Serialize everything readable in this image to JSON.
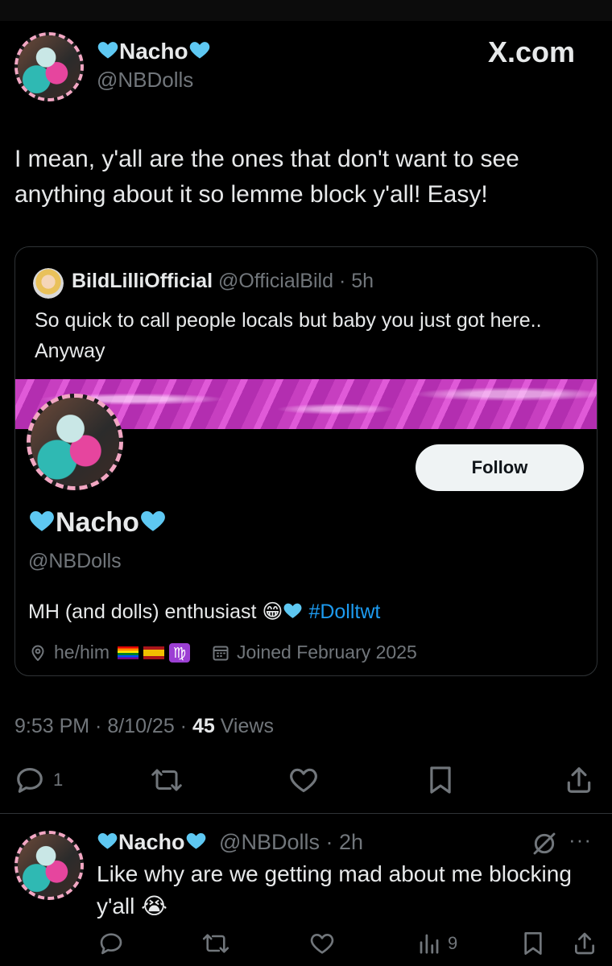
{
  "site_label": "X.com",
  "main_tweet": {
    "display_name": "Nacho",
    "handle": "@NBDolls",
    "text": "I mean, y'all are the ones that don't want to see anything about it so lemme block y'all! Easy!",
    "timestamp": "9:53 PM · 8/10/25 · ",
    "views_count": "45",
    "views_label": " Views",
    "reply_count": "1"
  },
  "quoted_tweet": {
    "display_name": "BildLilliOfficial",
    "handle": "@OfficialBild",
    "time": "· 5h",
    "text": "So quick to call people locals but baby you just got here.. Anyway",
    "card": {
      "display_name": "Nacho",
      "handle": "@NBDolls",
      "follow_label": "Follow",
      "bio_text": "MH (and dolls) enthusiast",
      "hashtag": "#Dolltwt",
      "pronouns": "he/him",
      "joined": "Joined February 2025"
    }
  },
  "reply_tweet": {
    "display_name": "Nacho",
    "handle": "@NBDolls",
    "time": "· 2h",
    "text": "Like why are we getting mad about me blocking y'all 😭",
    "views_count": "9",
    "more_label": "···"
  },
  "colors": {
    "heart": "#5ec8f2",
    "link": "#1d9bf0",
    "muted": "#71767b",
    "avatar_border": "#f2a7c3"
  }
}
